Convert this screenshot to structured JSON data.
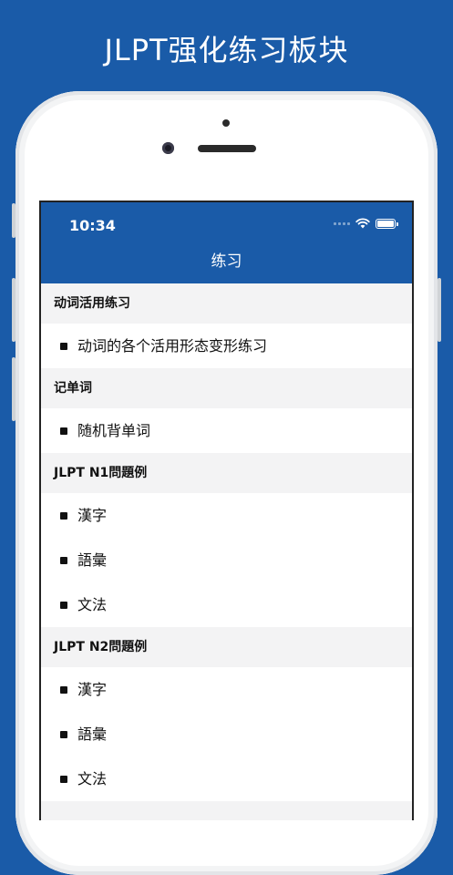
{
  "banner": {
    "title": "JLPT强化练习板块"
  },
  "status": {
    "time": "10:34"
  },
  "nav": {
    "title": "练习"
  },
  "sections": [
    {
      "header": "动词活用练习",
      "items": [
        "动词的各个活用形态变形练习"
      ]
    },
    {
      "header": "记单词",
      "items": [
        "随机背单词"
      ]
    },
    {
      "header": "JLPT N1問題例",
      "items": [
        "漢字",
        "語彙",
        "文法"
      ]
    },
    {
      "header": "JLPT N2問題例",
      "items": [
        "漢字",
        "語彙",
        "文法"
      ]
    }
  ],
  "colors": {
    "brand": "#1a5ba8",
    "header_bg": "#f3f3f4"
  }
}
